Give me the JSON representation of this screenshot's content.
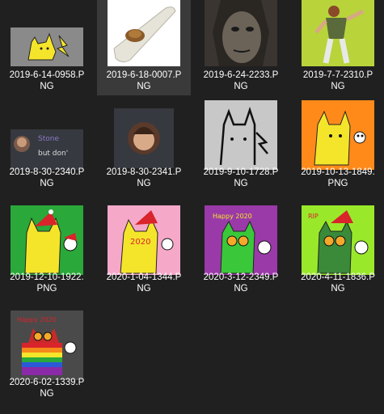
{
  "files": [
    {
      "name": "2019-6-14-0958.P\nNG",
      "icon": "pikachu-drawing-thumbnail"
    },
    {
      "name": "2019-6-18-0007.P\nNG",
      "icon": "kazoo-photo-thumbnail"
    },
    {
      "name": "2019-6-24-2233.P\nNG",
      "icon": "face-photo-thumbnail"
    },
    {
      "name": "2019-7-7-2310.P\nNG",
      "icon": "dancing-man-thumbnail"
    },
    {
      "name": "2019-8-30-2340.P\nNG",
      "icon": "chat-screenshot-thumbnail",
      "chat_text": [
        "Stone",
        "but don'"
      ]
    },
    {
      "name": "2019-8-30-2341.P\nNG",
      "icon": "avatar-screenshot-thumbnail"
    },
    {
      "name": "2019-9-10-1728.P\nNG",
      "icon": "sketch-drawing-thumbnail"
    },
    {
      "name": "2019-10-13-1849.\nPNG",
      "icon": "pikachu-orange-thumbnail"
    },
    {
      "name": "2019-12-10-1922.\nPNG",
      "icon": "pikachu-christmas-thumbnail"
    },
    {
      "name": "2020-1-04-1344.P\nNG",
      "icon": "pikachu-pink-thumbnail",
      "caption": "2020"
    },
    {
      "name": "2020-3-12-2349.P\nNG",
      "icon": "purple-green-drawing-thumbnail",
      "caption": "Happy 2020"
    },
    {
      "name": "2020-4-11-1836.P\nNG",
      "icon": "lime-drawing-thumbnail",
      "caption": "RIP"
    },
    {
      "name": "2020-6-02-1339.P\nNG",
      "icon": "rainbow-drawing-thumbnail",
      "caption": "Happy 2020"
    }
  ],
  "colors": {
    "background": "#202020",
    "selected": "#3a3a3a",
    "text": "#ffffff"
  }
}
